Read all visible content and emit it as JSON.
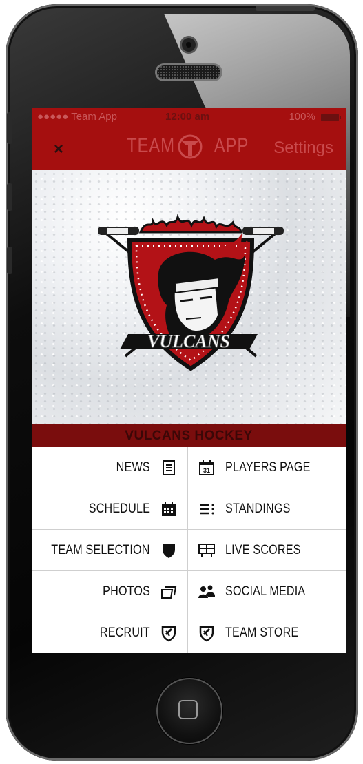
{
  "status_bar": {
    "carrier": "●●●●● Team App",
    "time": "12:00 am",
    "battery": "100%"
  },
  "nav": {
    "close": "×",
    "logo_left": "TEAM",
    "logo_right": "APP",
    "settings": "Settings"
  },
  "hero": {
    "logo_text": "VULCANS"
  },
  "team_bar": {
    "title": "VULCANS HOCKEY"
  },
  "menu": {
    "rows": [
      {
        "left": {
          "label": "NEWS",
          "icon": "news-icon"
        },
        "right": {
          "label": "PLAYERS PAGE",
          "icon": "calendar-icon"
        }
      },
      {
        "left": {
          "label": "SCHEDULE",
          "icon": "schedule-icon"
        },
        "right": {
          "label": "STANDINGS",
          "icon": "standings-icon"
        }
      },
      {
        "left": {
          "label": "TEAM SELECTION",
          "icon": "shield-icon"
        },
        "right": {
          "label": "LIVE SCORES",
          "icon": "scoreboard-icon"
        }
      },
      {
        "left": {
          "label": "PHOTOS",
          "icon": "photos-icon"
        },
        "right": {
          "label": "SOCIAL MEDIA",
          "icon": "people-icon"
        }
      },
      {
        "left": {
          "label": "RECRUIT",
          "icon": "badge-icon"
        },
        "right": {
          "label": "TEAM STORE",
          "icon": "badge-icon"
        }
      }
    ]
  },
  "colors": {
    "brand_red": "#a50f0f",
    "team_bar": "#7a0d0d"
  }
}
